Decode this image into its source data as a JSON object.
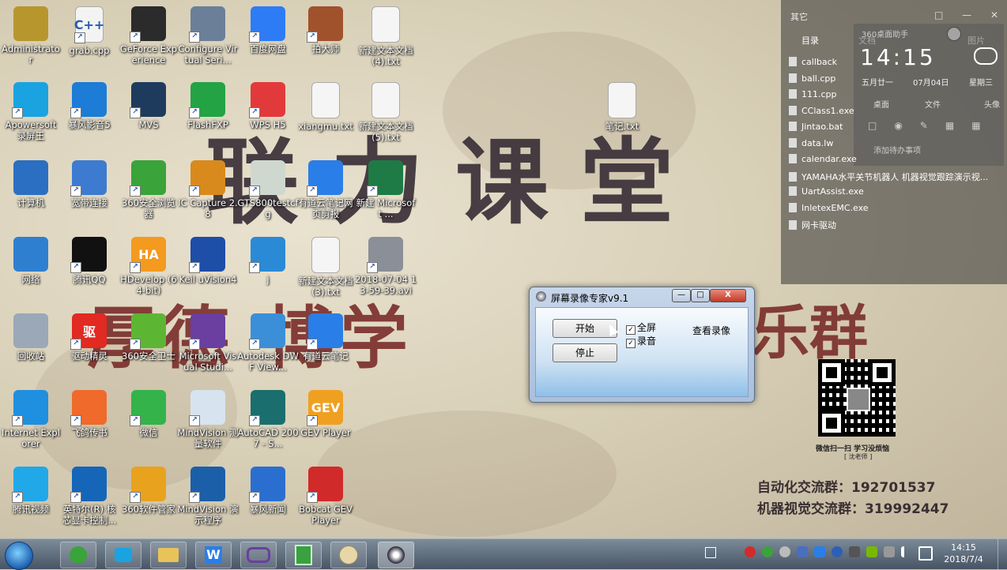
{
  "watermark": {
    "line1": "联力课堂",
    "line2": "厚德  博学",
    "line3": "乐群"
  },
  "desktop_icons": [
    {
      "label": "Administrator",
      "color": "#b8962e",
      "glyph": "folder-user-icon"
    },
    {
      "label": "grab.cpp",
      "color": "#f3f3f3",
      "glyph": "cpp-file-icon",
      "text": "C++"
    },
    {
      "label": "GeForce Experience",
      "color": "#2b2b2b",
      "glyph": "nvidia-icon"
    },
    {
      "label": "Configure Virtual Seri...",
      "color": "#6b7f99",
      "glyph": "serial-icon"
    },
    {
      "label": "百度网盘",
      "color": "#2d7cf6",
      "glyph": "cloud-icon"
    },
    {
      "label": "拍大师",
      "color": "#a0522d",
      "glyph": "camera-icon"
    },
    {
      "label": "新建文本文档 (4).txt",
      "color": "#f5f5f5",
      "glyph": "text-file-icon"
    },
    {
      "label": "Apowersoft 录屏王",
      "color": "#1aa3e0",
      "glyph": "video-icon"
    },
    {
      "label": "暴风影音5",
      "color": "#1c7cd6",
      "glyph": "player-icon"
    },
    {
      "label": "MVS",
      "color": "#1e3b5e",
      "glyph": "mvs-icon"
    },
    {
      "label": "FlashFXP",
      "color": "#23a344",
      "glyph": "ftp-icon"
    },
    {
      "label": "WPS H5",
      "color": "#e23a3a",
      "glyph": "wps-icon"
    },
    {
      "label": "xiangmu.txt",
      "color": "#f5f5f5",
      "glyph": "text-file-icon"
    },
    {
      "label": "新建文本文档 (5).txt",
      "color": "#f5f5f5",
      "glyph": "text-file-icon"
    },
    {
      "label": "笔记.txt",
      "color": "#f5f5f5",
      "glyph": "text-file-icon"
    },
    {
      "label": "计算机",
      "color": "#2b6fc2",
      "glyph": "computer-icon"
    },
    {
      "label": "宽带连接",
      "color": "#3d7bd0",
      "glyph": "network-icon"
    },
    {
      "label": "360安全浏览器",
      "color": "#3aa33a",
      "glyph": "browser-icon"
    },
    {
      "label": "IC Capture 2.8",
      "color": "#d98a1d",
      "glyph": "capture-icon"
    },
    {
      "label": "GTS800testcfg",
      "color": "#cfd8cf",
      "glyph": "cfg-icon"
    },
    {
      "label": "有道云笔记网页剪报",
      "color": "#2a7ee8",
      "glyph": "clip-icon"
    },
    {
      "label": "新建 Microsoft ...",
      "color": "#1e7b45",
      "glyph": "excel-icon"
    },
    {
      "label": "网络",
      "color": "#2f7fd1",
      "glyph": "globe-icon"
    },
    {
      "label": "腾讯QQ",
      "color": "#111111",
      "glyph": "qq-icon"
    },
    {
      "label": "HDevelop (64-bit)",
      "color": "#f39a1f",
      "glyph": "halcon-icon",
      "text": "HA"
    },
    {
      "label": "Keil uVision4",
      "color": "#1d4ea8",
      "glyph": "keil-icon"
    },
    {
      "label": "j",
      "color": "#2a8ad6",
      "glyph": "j-icon"
    },
    {
      "label": "新建文本文档 (3).txt",
      "color": "#f5f5f5",
      "glyph": "text-file-icon"
    },
    {
      "label": "2018-07-04 13-59-39.avi",
      "color": "#8a8f98",
      "glyph": "video-file-icon"
    },
    {
      "label": "回收站",
      "color": "#9aa8b8",
      "glyph": "recycle-bin-icon"
    },
    {
      "label": "驱动精灵",
      "color": "#e02a22",
      "glyph": "driver-icon",
      "text": "驱"
    },
    {
      "label": "360安全卫士",
      "color": "#5cb634",
      "glyph": "shield-icon"
    },
    {
      "label": "Microsoft Visual Studi...",
      "color": "#6a3fa0",
      "glyph": "vs-icon"
    },
    {
      "label": "Autodesk DWF View...",
      "color": "#3b8fd9",
      "glyph": "dwf-icon"
    },
    {
      "label": "有道云笔记",
      "color": "#2a7ee8",
      "glyph": "note-icon"
    },
    {
      "label": "Internet Explorer",
      "color": "#1f8fe0",
      "glyph": "ie-icon"
    },
    {
      "label": "飞鸽传书",
      "color": "#ef6a2b",
      "glyph": "feige-icon"
    },
    {
      "label": "微信",
      "color": "#33b34a",
      "glyph": "wechat-icon"
    },
    {
      "label": "MindVision 测量软件",
      "color": "#d8e3f0",
      "glyph": "measure-icon"
    },
    {
      "label": "AutoCAD 2007 - S...",
      "color": "#1a6e6e",
      "glyph": "autocad-icon"
    },
    {
      "label": "GEV Player",
      "color": "#f0a020",
      "glyph": "gev-icon",
      "text": "GEV"
    },
    {
      "label": "腾讯视频",
      "color": "#21a8e8",
      "glyph": "tencent-video-icon"
    },
    {
      "label": "英特尔(R) 核芯显卡控制...",
      "color": "#1565b8",
      "glyph": "intel-icon"
    },
    {
      "label": "360软件管家",
      "color": "#e8a21d",
      "glyph": "softmgr-icon"
    },
    {
      "label": "MindVision 演示程序",
      "color": "#1b5fa8",
      "glyph": "demo-icon"
    },
    {
      "label": "暴风新闻",
      "color": "#2a6fd0",
      "glyph": "news-icon"
    },
    {
      "label": "Bobcat GEV Player",
      "color": "#d12a2a",
      "glyph": "bobcat-icon"
    }
  ],
  "gadget": {
    "header": "其它",
    "tabs": [
      "目录",
      "文档",
      "图片"
    ],
    "helper_title": "360桌面助手",
    "time": "14:15",
    "lunar": "五月廿一",
    "date": "07月04日",
    "weekday": "星期三",
    "quick": [
      "桌面",
      "文件",
      "头像"
    ],
    "add_todo": "添加待办事项",
    "files": [
      "callback",
      "ball.cpp",
      "111.cpp",
      "CClass1.exe",
      "Jintao.bat",
      "data.lw",
      "calendar.exe",
      "YAMAHA水平关节机器人 机器视觉跟踪演示视...",
      "UartAssist.exe",
      "InletexEMC.exe",
      "网卡驱动"
    ]
  },
  "qr": {
    "caption": "微信扫一扫 学习没烦恼",
    "sub": "[ 沈老师 ]"
  },
  "contact": {
    "line1": "自动化交流群：192701537",
    "line2": "机器视觉交流群：319992447"
  },
  "recorder": {
    "title": "屏幕录像专家v9.1",
    "start": "开始",
    "stop": "停止",
    "fullscreen": "全屏",
    "record_audio": "录音",
    "view": "查看录像",
    "min": "—",
    "max": "□",
    "close": "X"
  },
  "taskbar": {
    "time": "14:15",
    "date": "2018/7/4"
  }
}
